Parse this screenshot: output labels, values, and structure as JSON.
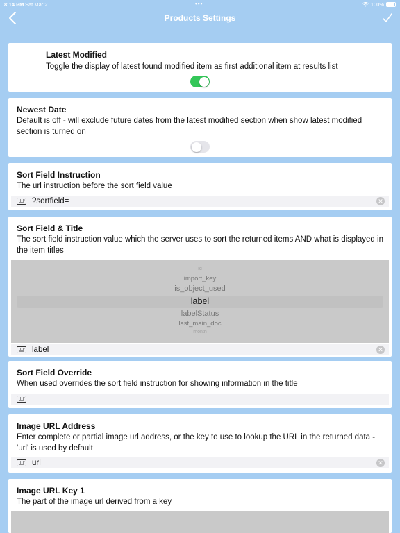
{
  "status": {
    "time": "8:14 PM",
    "date": "Sat Mar 2",
    "battery": "100%"
  },
  "nav": {
    "title": "Products Settings",
    "icons": {
      "back": "chevron-left-icon",
      "done": "checkmark-icon"
    }
  },
  "colors": {
    "background": "#a5cdf2",
    "toggle_on": "#34c759",
    "toggle_off": "#e5e5ea"
  },
  "sections": {
    "latest_modified": {
      "title": "Latest Modified",
      "desc": "Toggle the display of latest found modified item as first additional item at results list",
      "toggle_on": true
    },
    "newest_date": {
      "title": "Newest Date",
      "desc": "Default is off - will exclude future dates from the latest modified section when show latest modified section is turned on",
      "toggle_on": false
    },
    "sort_field_instruction": {
      "title": "Sort Field Instruction",
      "desc": "The url instruction before the sort field value",
      "value": "?sortfield="
    },
    "sort_field_title": {
      "title": "Sort Field & Title",
      "desc": "The sort field instruction value which the server uses to sort the returned items AND what is displayed in the item titles",
      "picker_options": [
        "id",
        "import_key",
        "is_object_used",
        "label",
        "labelStatus",
        "last_main_doc",
        "month"
      ],
      "selected": "label",
      "value": "label"
    },
    "sort_field_override": {
      "title": "Sort Field Override",
      "desc": "When used overrides the sort field instruction for showing information in the title",
      "value": ""
    },
    "image_url_address": {
      "title": "Image URL Address",
      "desc": "Enter complete or partial image url address, or the key to use to lookup the URL in the returned data - 'url' is used by default",
      "value": "url"
    },
    "image_url_key_1": {
      "title": "Image URL Key 1",
      "desc": "The part of the image url derived from a key"
    }
  }
}
